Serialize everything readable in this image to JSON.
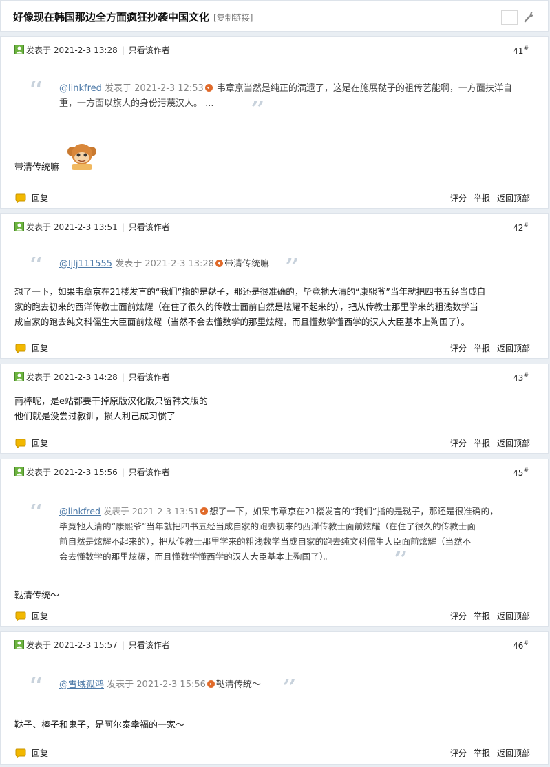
{
  "thread": {
    "title": "好像现在韩国那边全方面疯狂抄袭中国文化",
    "copy_link": "[复制链接]"
  },
  "post_meta_label": "发表于",
  "only_author_label": "只看该作者",
  "actions": {
    "reply": "回复",
    "rate": "评分",
    "report": "举报",
    "top": "返回顶部"
  },
  "colors": {
    "background": "#e9eef3",
    "link": "#4d7aa8",
    "quote_mark": "#c8d2dc",
    "bubble": "#f2b800"
  },
  "posts": [
    {
      "time": "2021-2-3 13:28",
      "floor": "41",
      "quote_user": "@linkfred",
      "quote_time": "发表于 2021-2-3 12:53",
      "quote_line1": " 韦章京当然是纯正的满遗了，这是在施展鞑子的祖传艺能啊，一方面扶洋自",
      "quote_line2": "重，一方面以旗人的身份污蔑汉人。 ...",
      "body": "带清传统嘛"
    },
    {
      "time": "2021-2-3 13:51",
      "floor": "42",
      "quote_user": "@ljlj111555",
      "quote_time": "发表于 2021-2-3 13:28",
      "quote_line1": "带清传统嘛",
      "body_lines": [
        "想了一下，如果韦章京在21楼发言的“我们”指的是鞑子，那还是很准确的，毕竟牠大清的“康熙爷”当年就把四书五经当成自",
        "家的跑去初来的西洋传教士面前炫耀（在住了很久的传教士面前自然是炫耀不起来的），把从传教士那里学来的粗浅数学当",
        "成自家的跑去纯文科儒生大臣面前炫耀（当然不会去懂数学的那里炫耀，而且懂数学懂西学的汉人大臣基本上殉国了）。"
      ]
    },
    {
      "time": "2021-2-3 14:28",
      "floor": "43",
      "body_lines": [
        "南棒呢，是e站都要干掉原版汉化版只留韩文版的",
        "他们就是没尝过教训，损人利己成习惯了"
      ]
    },
    {
      "time": "2021-2-3 15:56",
      "floor": "45",
      "quote_user": "@linkfred",
      "quote_time": "发表于 2021-2-3 13:51",
      "quote_lines": [
        "想了一下，如果韦章京在21楼发言的“我们”指的是鞑子，那还是很准确的，",
        "毕竟牠大清的“康熙爷”当年就把四书五经当成自家的跑去初来的西洋传教士面前炫耀（在住了很久的传教士面",
        "前自然是炫耀不起来的），把从传教士那里学来的粗浅数学当成自家的跑去纯文科儒生大臣面前炫耀（当然不",
        "会去懂数学的那里炫耀，而且懂数学懂西学的汉人大臣基本上殉国了）。"
      ],
      "body": "鞑清传统～"
    },
    {
      "time": "2021-2-3 15:57",
      "floor": "46",
      "quote_user": "@雪域孤鸿",
      "quote_time": "发表于 2021-2-3 15:56",
      "quote_line1": "鞑清传统～",
      "body": "鞑子、棒子和鬼子，是阿尔泰幸福的一家～"
    }
  ]
}
